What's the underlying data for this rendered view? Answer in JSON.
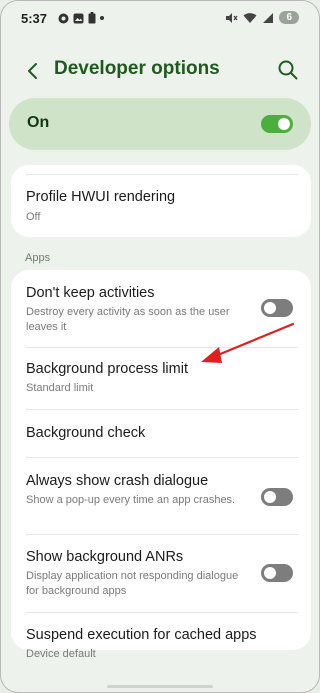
{
  "status_bar": {
    "time": "5:37",
    "badge": "6"
  },
  "header": {
    "title": "Developer options"
  },
  "master_switch": {
    "label": "On",
    "state": "on"
  },
  "card_top": {
    "items": [
      {
        "title": "Profile HWUI rendering",
        "subtitle": "Off"
      }
    ]
  },
  "section_apps": {
    "label": "Apps",
    "items": [
      {
        "title": "Don't keep activities",
        "subtitle": "Destroy every activity as soon as the user leaves it",
        "toggle": "off"
      },
      {
        "title": "Background process limit",
        "subtitle": "Standard limit"
      },
      {
        "title": "Background check",
        "subtitle": ""
      },
      {
        "title": "Always show crash dialogue",
        "subtitle": "Show a pop-up every time an app crashes.",
        "toggle": "off"
      },
      {
        "title": "Show background ANRs",
        "subtitle": "Display application not responding dialogue for background apps",
        "toggle": "off"
      },
      {
        "title": "Suspend execution for cached apps",
        "subtitle": "Device default"
      }
    ]
  },
  "colors": {
    "accent": "#4caf3d",
    "title": "#1f5b1f",
    "annotation_arrow": "#e02020"
  }
}
